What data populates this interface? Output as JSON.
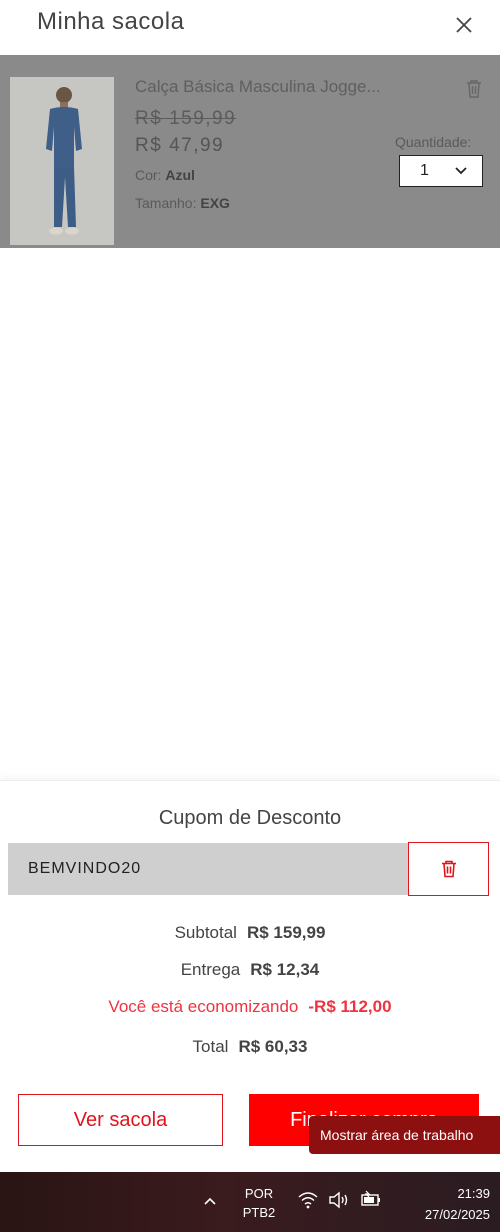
{
  "header": {
    "title": "Minha sacola"
  },
  "item": {
    "name": "Calça Básica Masculina Jogge...",
    "old_price": "R$ 159,99",
    "new_price": "R$ 47,99",
    "color_label": "Cor:",
    "color_value": "Azul",
    "size_label": "Tamanho:",
    "size_value": "EXG",
    "quantity_label": "Quantidade:",
    "quantity_value": "1"
  },
  "coupon": {
    "title": "Cupom de Desconto",
    "code": "BEMVINDO20"
  },
  "summary": {
    "subtotal_label": "Subtotal",
    "subtotal_value": "R$ 159,99",
    "delivery_label": "Entrega",
    "delivery_value": "R$ 12,34",
    "saving_label": "Você está economizando",
    "saving_value": "-R$ 112,00",
    "total_label": "Total",
    "total_value": "R$ 60,33"
  },
  "buttons": {
    "view_bag": "Ver sacola",
    "checkout": "Finalizar compra"
  },
  "tooltip": {
    "text": "Mostrar área de trabalho"
  },
  "taskbar": {
    "lang_line1": "POR",
    "lang_line2": "PTB2",
    "time": "21:39",
    "date": "27/02/2025"
  },
  "colors": {
    "accent": "#ff0000",
    "accent_border": "#e0141c",
    "saving": "#ef3340",
    "overlay": "#8a8a8a"
  }
}
